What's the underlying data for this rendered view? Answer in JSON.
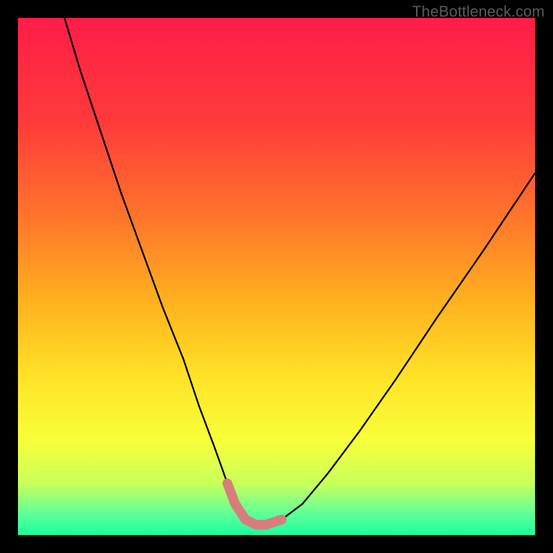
{
  "watermark": "TheBottleneck.com",
  "chart_data": {
    "type": "line",
    "title": "",
    "xlabel": "",
    "ylabel": "",
    "xlim": [
      0,
      100
    ],
    "ylim": [
      0,
      100
    ],
    "gradient_stops": [
      {
        "offset": 0,
        "color": "#ff1d48"
      },
      {
        "offset": 20,
        "color": "#ff3a3a"
      },
      {
        "offset": 40,
        "color": "#ff7a2a"
      },
      {
        "offset": 55,
        "color": "#ffb21e"
      },
      {
        "offset": 70,
        "color": "#ffe428"
      },
      {
        "offset": 82,
        "color": "#f7ff3a"
      },
      {
        "offset": 90,
        "color": "#c8ff5a"
      },
      {
        "offset": 96,
        "color": "#5dff9a"
      },
      {
        "offset": 100,
        "color": "#19ff9c"
      }
    ],
    "series": [
      {
        "name": "bottleneck-curve",
        "x": [
          9,
          12,
          16,
          20,
          24,
          28,
          32,
          35,
          38,
          40.5,
          42,
          44,
          46,
          48,
          51,
          55,
          60,
          66,
          73,
          81,
          90,
          100
        ],
        "y": [
          100,
          90,
          78,
          66,
          55,
          44,
          34,
          25,
          17,
          10,
          6,
          3,
          2,
          2,
          3,
          6,
          12,
          20,
          30,
          42,
          55,
          70
        ]
      }
    ],
    "highlight": {
      "name": "trough-highlight",
      "color": "#d87d7d",
      "x": [
        40.5,
        42,
        44,
        46,
        48,
        51
      ],
      "y": [
        10,
        6,
        3,
        2,
        2,
        3
      ]
    }
  }
}
